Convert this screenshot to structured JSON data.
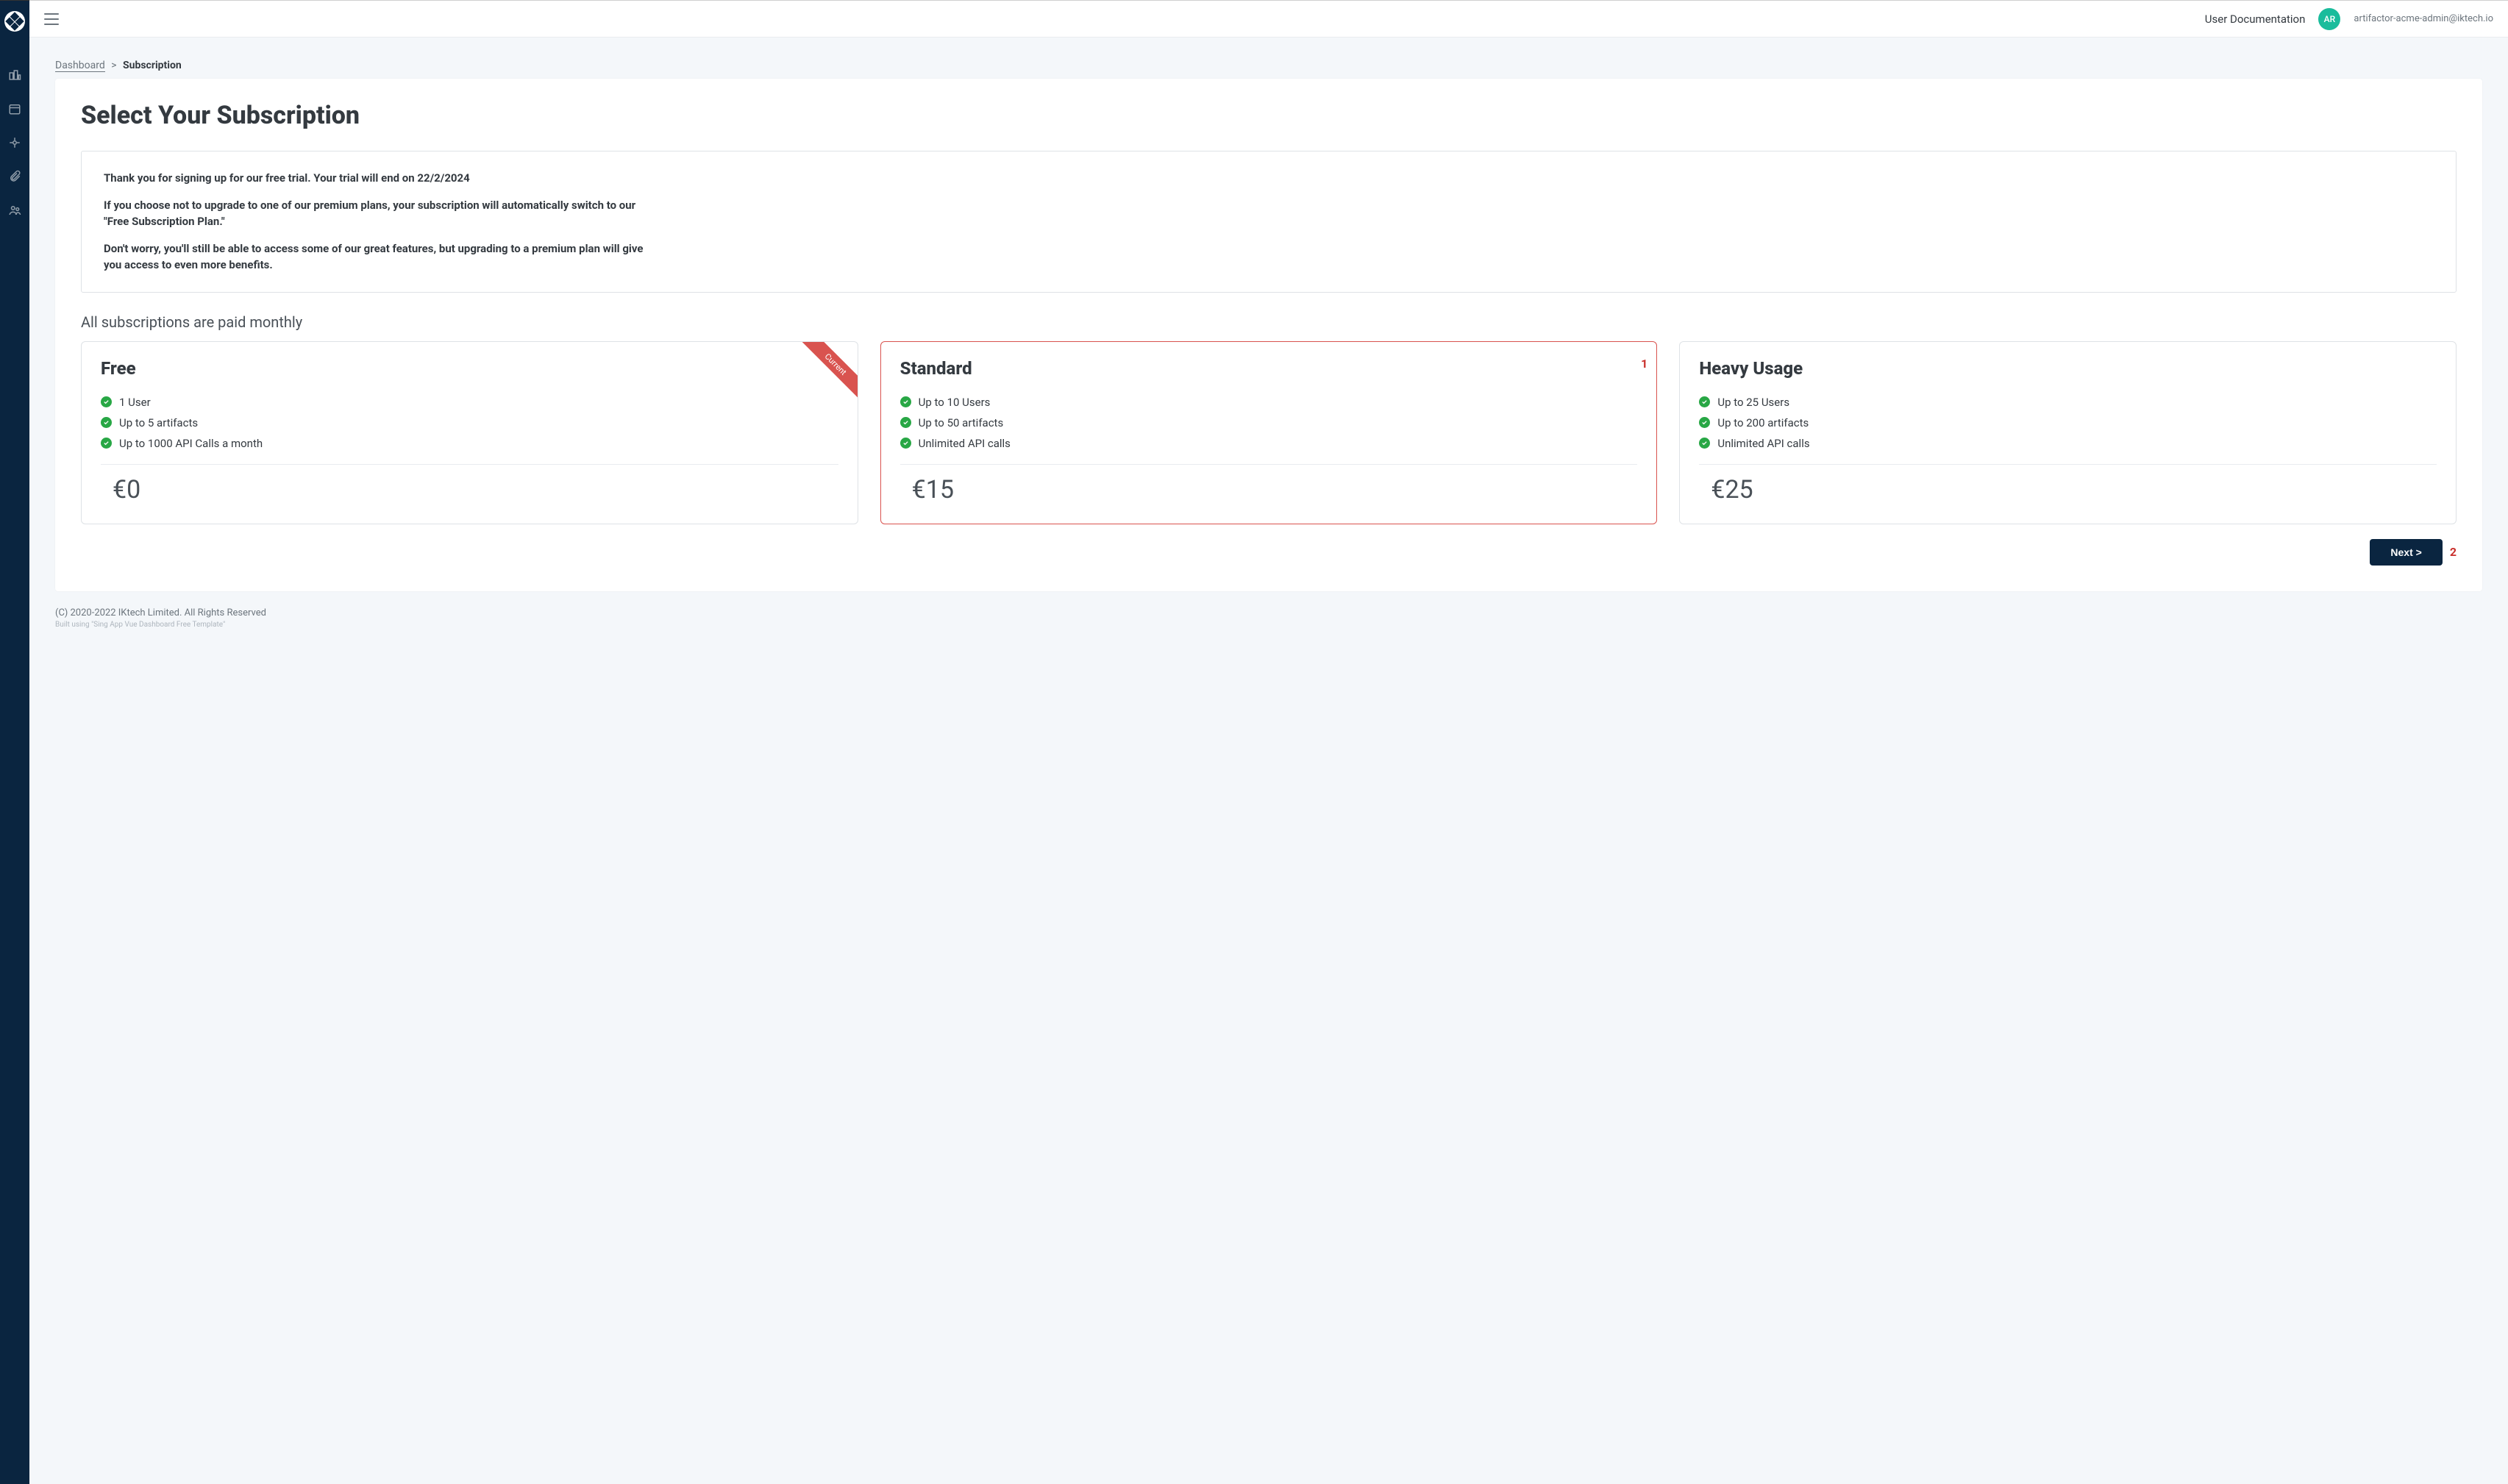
{
  "header": {
    "doc_link": "User Documentation",
    "avatar_initials": "AR",
    "user_email": "artifactor-acme-admin@iktech.io"
  },
  "breadcrumb": {
    "root": "Dashboard",
    "separator": ">",
    "current": "Subscription"
  },
  "page": {
    "title": "Select Your Subscription",
    "info_line1": "Thank you for signing up for our free trial. Your trial will end on 22/2/2024",
    "info_line2": "If you choose not to upgrade to one of our premium plans, your subscription will automatically switch to our \"Free Subscription Plan.\"",
    "info_line3": "Don't worry, you'll still be able to access some of our great features, but upgrading to a premium plan will give you access to even more benefits.",
    "sub_heading": "All subscriptions are paid monthly",
    "next_label": "Next >"
  },
  "plans": [
    {
      "name": "Free",
      "feature1": "1 User",
      "feature2": "Up to 5 artifacts",
      "feature3": "Up to 1000 API Calls a month",
      "price": "€0",
      "ribbon": "Current",
      "selected": false
    },
    {
      "name": "Standard",
      "feature1": "Up to 10 Users",
      "feature2": "Up to 50 artifacts",
      "feature3": "Unlimited API calls",
      "price": "€15",
      "ribbon": "",
      "selected": true
    },
    {
      "name": "Heavy Usage",
      "feature1": "Up to 25 Users",
      "feature2": "Up to 200 artifacts",
      "feature3": "Unlimited API calls",
      "price": "€25",
      "ribbon": "",
      "selected": false
    }
  ],
  "annotations": {
    "one": "1",
    "two": "2"
  },
  "footer": {
    "copyright": "(C) 2020-2022 IKtech Limited. All Rights Reserved",
    "credit": "Built using \"Sing App Vue Dashboard Free Template\""
  }
}
